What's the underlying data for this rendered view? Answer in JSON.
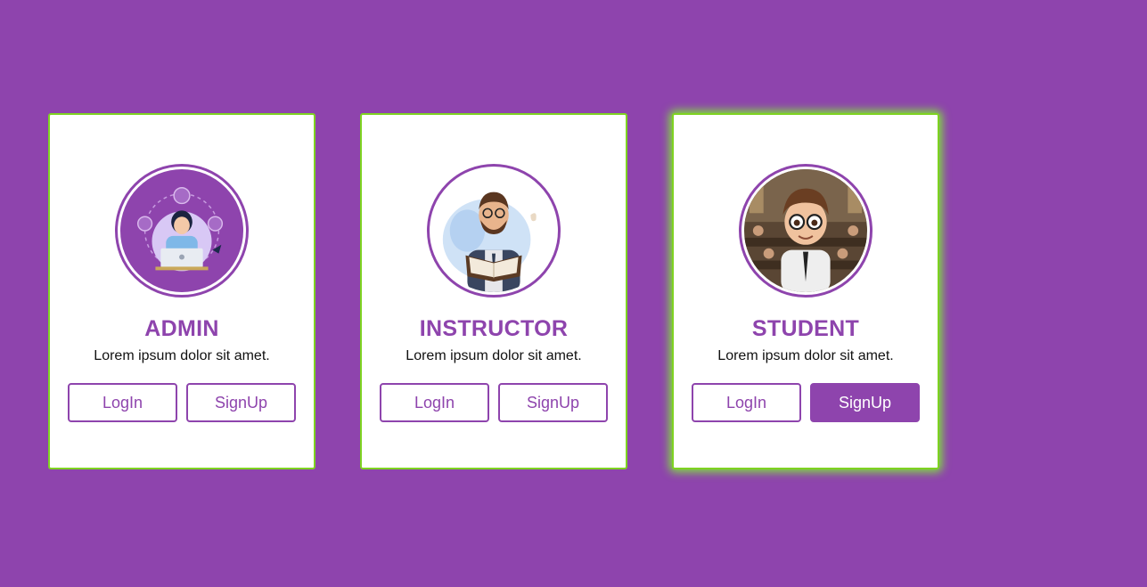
{
  "cards": [
    {
      "title": "ADMIN",
      "description": "Lorem ipsum dolor sit amet.",
      "login_label": "LogIn",
      "signup_label": "SignUp",
      "avatar_icon": "admin-support-avatar-icon"
    },
    {
      "title": "INSTRUCTOR",
      "description": "Lorem ipsum dolor sit amet.",
      "login_label": "LogIn",
      "signup_label": "SignUp",
      "avatar_icon": "instructor-avatar-icon"
    },
    {
      "title": "STUDENT",
      "description": "Lorem ipsum dolor sit amet.",
      "login_label": "LogIn",
      "signup_label": "SignUp",
      "avatar_icon": "student-avatar-icon"
    }
  ],
  "colors": {
    "background": "#8e44ad",
    "accent": "#8e44ad",
    "card_border": "#7ed321",
    "card_background": "#ffffff"
  }
}
